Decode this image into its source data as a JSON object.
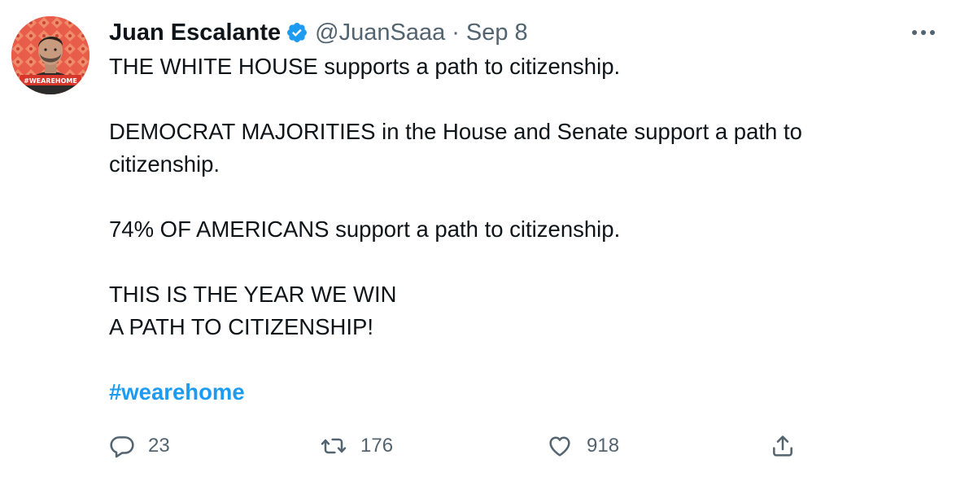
{
  "author": {
    "display_name": "Juan Escalante",
    "handle": "@JuanSaaa",
    "separator": "·",
    "time": "Sep 8",
    "verified": true,
    "avatar_badge_text": "#WEAREHOME"
  },
  "tweet": {
    "paragraphs": [
      [
        "THE WHITE HOUSE supports a path to citizenship."
      ],
      [
        "DEMOCRAT MAJORITIES in the House and Senate support a path to",
        "citizenship."
      ],
      [
        "74% OF AMERICANS support a path to citizenship."
      ],
      [
        "THIS IS THE YEAR WE WIN",
        "A PATH TO CITIZENSHIP!"
      ]
    ],
    "line_1": "THE WHITE HOUSE supports a path to citizenship.",
    "line_2": "DEMOCRAT MAJORITIES in the House and Senate support a path to",
    "line_3": "citizenship.",
    "line_4": "74% OF AMERICANS support a path to citizenship.",
    "line_5": "THIS IS THE YEAR WE WIN",
    "line_6": "A PATH TO CITIZENSHIP!",
    "hashtag": "#wearehome"
  },
  "actions": {
    "reply_count": "23",
    "retweet_count": "176",
    "like_count": "918"
  },
  "icons": {
    "verified": "verified-badge-icon",
    "more": "more-icon",
    "reply": "reply-icon",
    "retweet": "retweet-icon",
    "like": "heart-icon",
    "share": "share-icon"
  },
  "colors": {
    "text": "#0f1419",
    "secondary": "#536471",
    "accent": "#1d9bf0",
    "verified": "#1d9bf0",
    "avatar_bg": "#e85c4a"
  }
}
